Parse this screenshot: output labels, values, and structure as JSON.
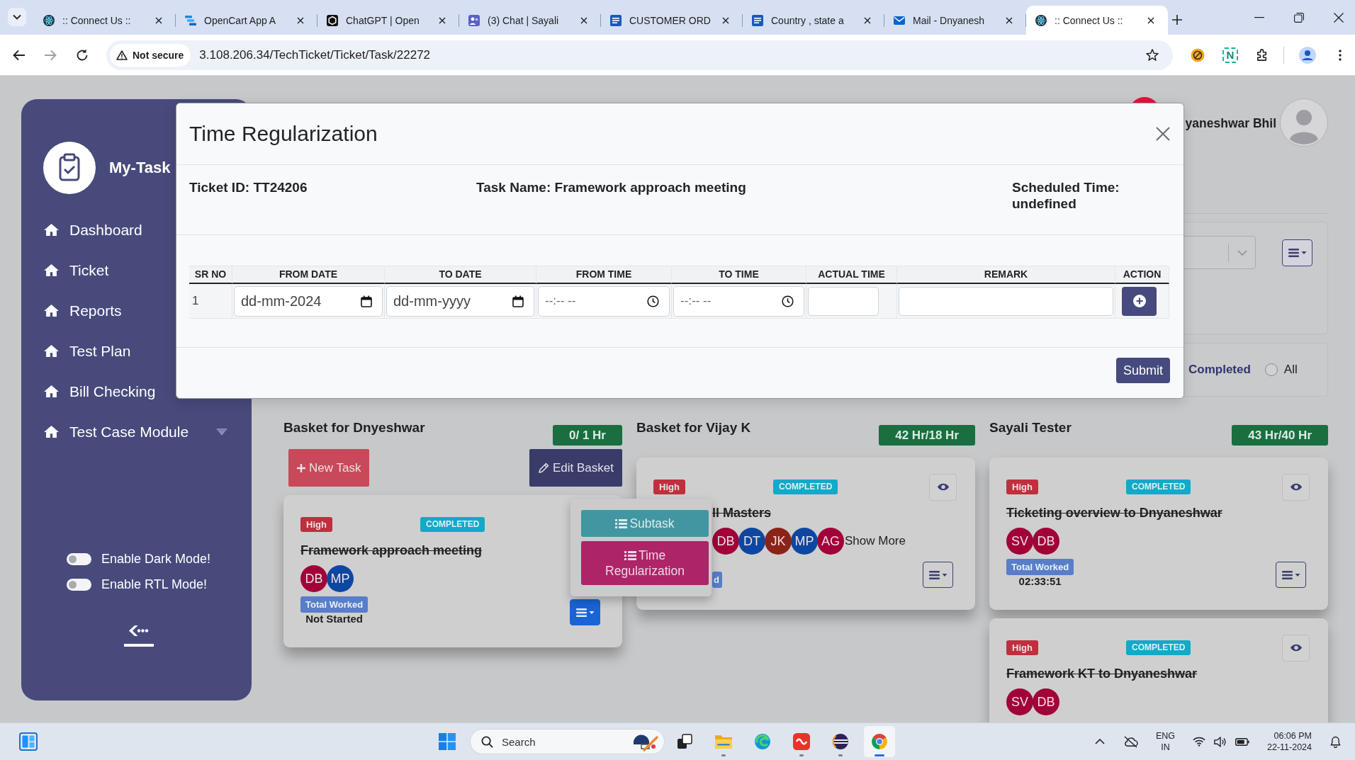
{
  "browser": {
    "tabs": [
      {
        "title": ":: Connect Us ::",
        "selected": false
      },
      {
        "title": "OpenCart App A",
        "selected": false
      },
      {
        "title": "ChatGPT | Open",
        "selected": false
      },
      {
        "title": "(3) Chat | Sayali",
        "selected": false
      },
      {
        "title": "CUSTOMER ORD",
        "selected": false
      },
      {
        "title": "Country , state a",
        "selected": false
      },
      {
        "title": "Mail - Dnyanesh",
        "selected": false
      },
      {
        "title": ":: Connect Us ::",
        "selected": true
      }
    ],
    "security_label": "Not secure",
    "url": "3.108.206.34/TechTicket/Ticket/Task/22272",
    "extension_label": "N"
  },
  "sidebar": {
    "brand": "My-Task",
    "nav": [
      {
        "label": "Dashboard",
        "expandable": false
      },
      {
        "label": "Ticket",
        "expandable": false
      },
      {
        "label": "Reports",
        "expandable": false
      },
      {
        "label": "Test Plan",
        "expandable": false
      },
      {
        "label": "Bill Checking",
        "expandable": false
      },
      {
        "label": "Test Case Module",
        "expandable": true
      }
    ],
    "toggles": [
      {
        "label": "Enable Dark Mode!",
        "on": false
      },
      {
        "label": "Enable RTL Mode!",
        "on": false
      }
    ]
  },
  "header": {
    "user_name": "yaneshwar Bhil"
  },
  "filter": {
    "options": [
      {
        "kind": "label",
        "label": "Completed",
        "selected": true
      },
      {
        "kind": "radio",
        "label": "All",
        "selected": false
      }
    ]
  },
  "baskets": [
    {
      "title": "Basket for Dnyeshwar",
      "hours": "0/ 1 Hr",
      "actions": [
        {
          "kind": "new",
          "label": "New Task"
        },
        {
          "kind": "edit",
          "label": "Edit Basket"
        }
      ],
      "tasks": [
        {
          "priority": "High",
          "status": "COMPLETED",
          "eye_button": false,
          "title": "Framework approach meeting",
          "done": true,
          "assignees": [
            {
              "initials": "DB",
              "color": "#a10038"
            },
            {
              "initials": "MP",
              "color": "#0d47a1"
            }
          ],
          "worked_label": "Total Worked",
          "worked_value": "Not Started",
          "menu": {
            "open": true,
            "items": [
              {
                "kind": "subtask",
                "label": "Subtask"
              },
              {
                "kind": "regularize",
                "label": "Time Regularization"
              }
            ]
          }
        }
      ]
    },
    {
      "title": "Basket for Vijay K",
      "hours": "42 Hr/18 Hr",
      "tasks": [
        {
          "priority": "High",
          "status": "COMPLETED",
          "eye_button": true,
          "title": "ll Masters",
          "done": true,
          "assignees": [
            {
              "initials": "DB",
              "color": "#a10038"
            },
            {
              "initials": "DT",
              "color": "#0d47a1"
            },
            {
              "initials": "JK",
              "color": "#8b2318"
            },
            {
              "initials": "MP",
              "color": "#0d47a1"
            },
            {
              "initials": "AG",
              "color": "#a10038"
            }
          ],
          "show_more": "Show More",
          "worked_label": "d",
          "menu": {
            "open": false
          }
        }
      ]
    },
    {
      "title": "Sayali Tester",
      "hours": "43 Hr/40 Hr",
      "tasks": [
        {
          "priority": "High",
          "status": "COMPLETED",
          "eye_button": true,
          "title": "Ticketing overview to Dnyaneshwar",
          "done": true,
          "assignees": [
            {
              "initials": "SV",
              "color": "#a10038"
            },
            {
              "initials": "DB",
              "color": "#a10038"
            }
          ],
          "worked_label": "Total Worked",
          "worked_value": "02:33:51",
          "menu": {
            "open": false
          }
        },
        {
          "priority": "High",
          "status": "COMPLETED",
          "eye_button": true,
          "title": "Framework KT to Dnyaneshwar",
          "done": true,
          "assignees": [
            {
              "initials": "SV",
              "color": "#a10038"
            },
            {
              "initials": "DB",
              "color": "#a10038"
            }
          ]
        }
      ]
    }
  ],
  "modal": {
    "title": "Time Regularization",
    "info": [
      "Ticket ID: TT24206",
      "Task Name: Framework approach meeting",
      "Scheduled Time: undefined"
    ],
    "columns": [
      "SR NO",
      "FROM DATE",
      "TO DATE",
      "FROM TIME",
      "TO TIME",
      "ACTUAL TIME",
      "REMARK",
      "ACTION"
    ],
    "rows": [
      {
        "sr_no": "1",
        "from_date": {
          "value": "dd-mm-2024"
        },
        "to_date": {
          "placeholder": "dd-mm-yyyy"
        },
        "from_time": {
          "placeholder": "--:-- --"
        },
        "to_time": {
          "placeholder": "--:-- --"
        }
      }
    ],
    "submit": "Submit"
  },
  "taskbar": {
    "search_placeholder": "Search",
    "apps": [
      {
        "running": false,
        "selected": false
      },
      {
        "running": true,
        "selected": false
      },
      {
        "running": false,
        "selected": false
      },
      {
        "running": true,
        "selected": false
      },
      {
        "running": true,
        "selected": false
      },
      {
        "running": true,
        "selected": true
      }
    ],
    "language": "ENG",
    "region": "IN",
    "time": "06:06 PM",
    "date": "22-11-2024"
  }
}
